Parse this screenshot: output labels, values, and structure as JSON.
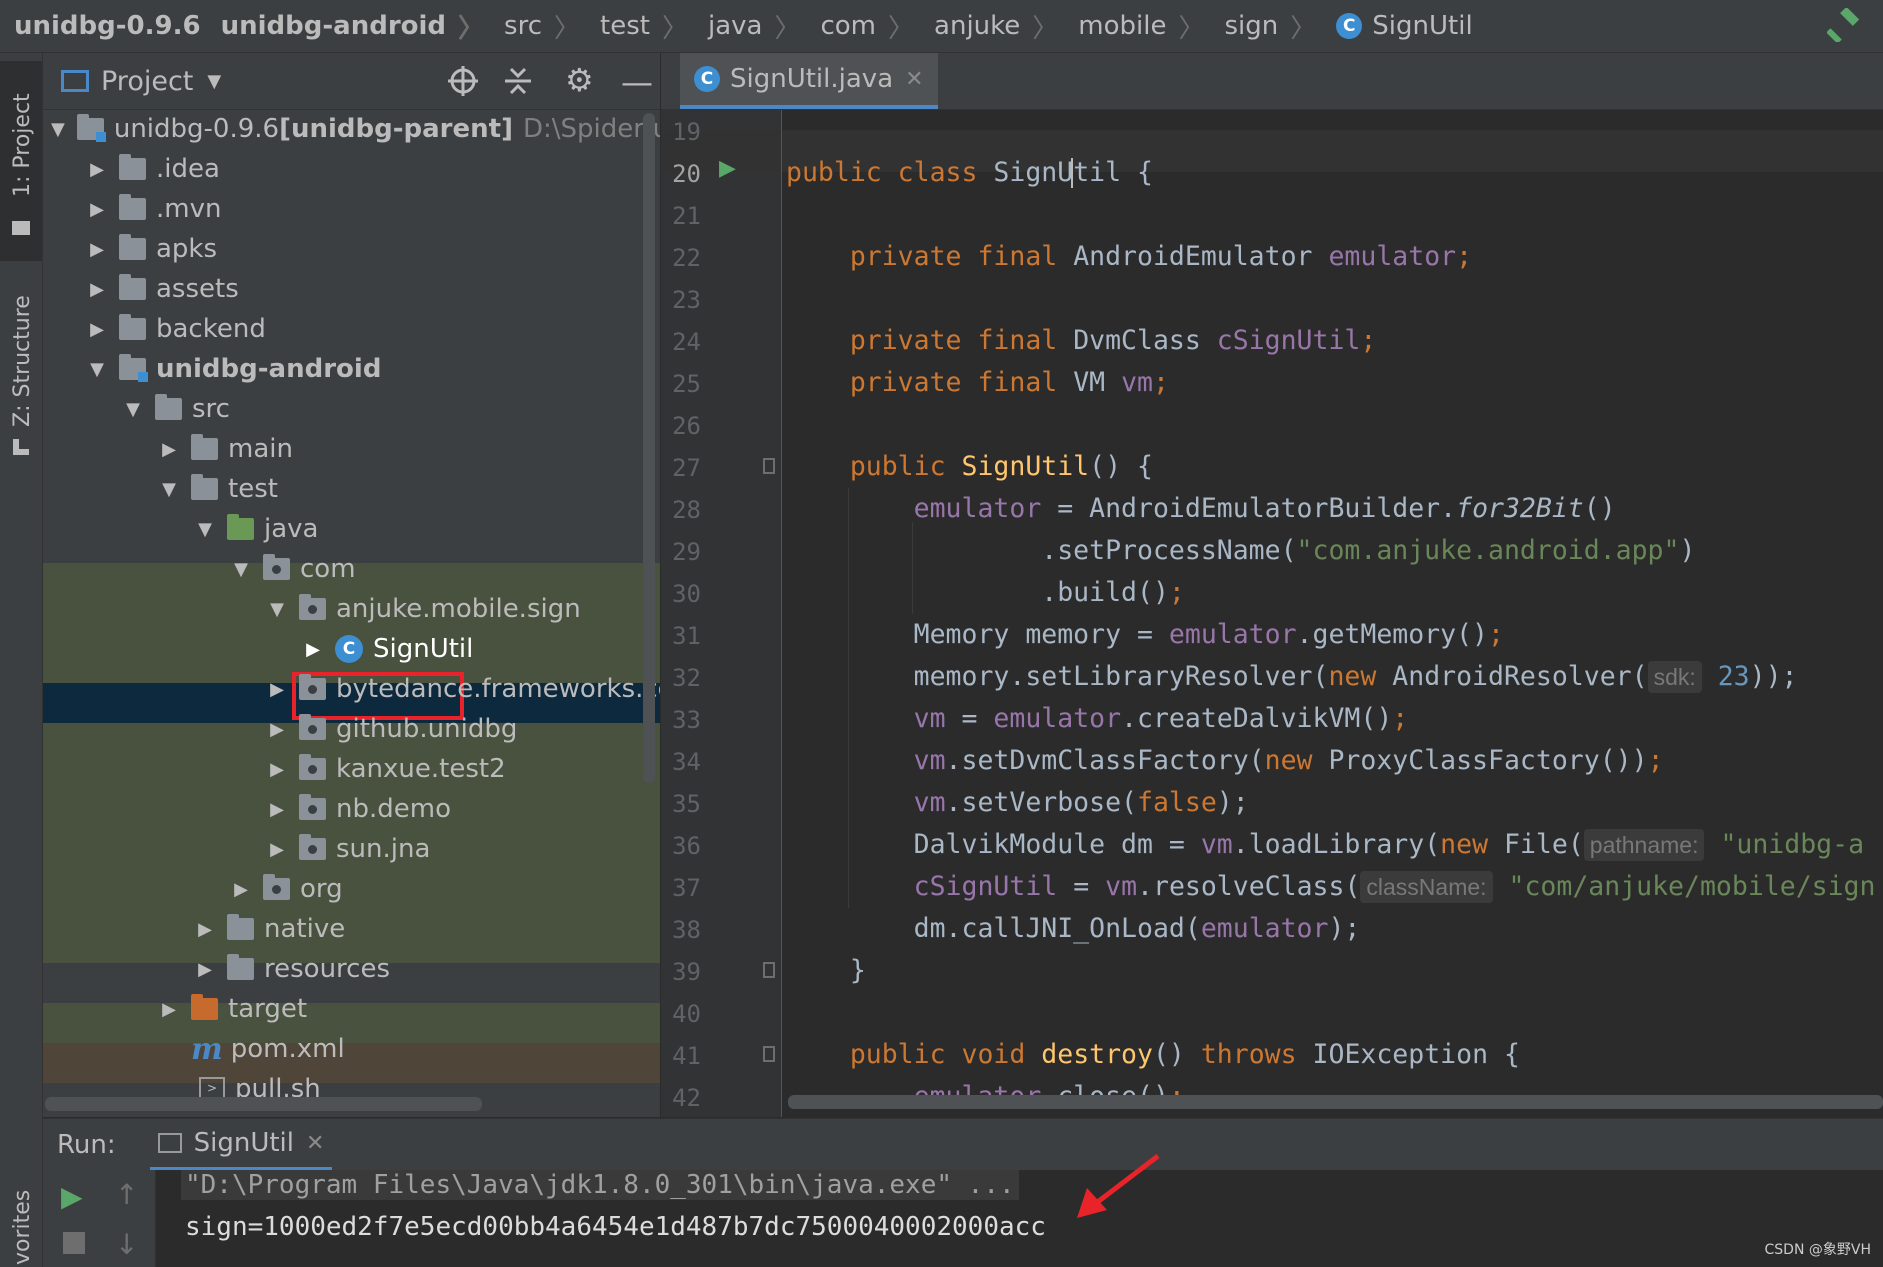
{
  "breadcrumbs": [
    "unidbg-0.9.6",
    "unidbg-android",
    "src",
    "test",
    "java",
    "com",
    "anjuke",
    "mobile",
    "sign",
    "SignUtil"
  ],
  "left_tabs": {
    "project": "1: Project",
    "structure": "Z: Structure",
    "favorites": "vorites"
  },
  "project_panel": {
    "title": "Project",
    "tree": [
      {
        "label": "unidbg-0.9.6",
        "suffix": " [unidbg-parent]",
        "extra": "D:\\Spider\\unidb",
        "depth": 0,
        "open": true,
        "kind": "mod"
      },
      {
        "label": ".idea",
        "depth": 1,
        "open": false,
        "kind": "folder"
      },
      {
        "label": ".mvn",
        "depth": 1,
        "open": false,
        "kind": "folder"
      },
      {
        "label": "apks",
        "depth": 1,
        "open": false,
        "kind": "folder"
      },
      {
        "label": "assets",
        "depth": 1,
        "open": false,
        "kind": "folder"
      },
      {
        "label": "backend",
        "depth": 1,
        "open": false,
        "kind": "folder"
      },
      {
        "label": "unidbg-android",
        "depth": 1,
        "open": true,
        "kind": "mod",
        "bold": true
      },
      {
        "label": "src",
        "depth": 2,
        "open": true,
        "kind": "folder"
      },
      {
        "label": "main",
        "depth": 3,
        "open": false,
        "kind": "folder"
      },
      {
        "label": "test",
        "depth": 3,
        "open": true,
        "kind": "folder"
      },
      {
        "label": "java",
        "depth": 4,
        "open": true,
        "kind": "green"
      },
      {
        "label": "com",
        "depth": 5,
        "open": true,
        "kind": "pkg"
      },
      {
        "label": "anjuke.mobile.sign",
        "depth": 6,
        "open": true,
        "kind": "pkg"
      },
      {
        "label": "SignUtil",
        "depth": 7,
        "open": false,
        "kind": "class",
        "selected": true
      },
      {
        "label": "bytedance.frameworks.core.",
        "depth": 6,
        "open": false,
        "kind": "pkg"
      },
      {
        "label": "github.unidbg",
        "depth": 6,
        "open": false,
        "kind": "pkg"
      },
      {
        "label": "kanxue.test2",
        "depth": 6,
        "open": false,
        "kind": "pkg"
      },
      {
        "label": "nb.demo",
        "depth": 6,
        "open": false,
        "kind": "pkg"
      },
      {
        "label": "sun.jna",
        "depth": 6,
        "open": false,
        "kind": "pkg"
      },
      {
        "label": "org",
        "depth": 5,
        "open": false,
        "kind": "pkg"
      },
      {
        "label": "native",
        "depth": 4,
        "open": false,
        "kind": "folder"
      },
      {
        "label": "resources",
        "depth": 4,
        "open": false,
        "kind": "res"
      },
      {
        "label": "target",
        "depth": 2,
        "open": false,
        "kind": "orange"
      },
      {
        "label": "pom.xml",
        "depth": 2,
        "open": null,
        "kind": "maven"
      },
      {
        "label": "pull.sh",
        "depth": 2,
        "open": null,
        "kind": "shell"
      }
    ]
  },
  "editor": {
    "tab_label": "SignUtil.java",
    "line_numbers": [
      "19",
      "20",
      "21",
      "22",
      "23",
      "24",
      "25",
      "26",
      "27",
      "28",
      "29",
      "30",
      "31",
      "32",
      "33",
      "34",
      "35",
      "36",
      "37",
      "38",
      "39",
      "40",
      "41",
      "42"
    ],
    "code": {
      "l20": {
        "kw1": "public class ",
        "cls1": "SignU",
        "cls2": "til",
        "rest": " {"
      },
      "l22": {
        "kw": "    private final ",
        "type": "AndroidEmulator ",
        "field": "emulator",
        "end": ";"
      },
      "l24": {
        "kw": "    private final ",
        "type": "DvmClass ",
        "field": "cSignUtil",
        "end": ";"
      },
      "l25": {
        "kw": "    private final ",
        "type": "VM ",
        "field": "vm",
        "end": ";"
      },
      "l27": {
        "kw": "    public ",
        "fn": "SignUtil",
        "rest": "() {"
      },
      "l28": {
        "field": "        emulator",
        "mid": " = AndroidEmulatorBuilder.",
        "it": "for32Bit",
        "end": "()"
      },
      "l29": {
        "pre": "                .setProcessName(",
        "str": "\"com.anjuke.android.app\"",
        "end": ")"
      },
      "l30": {
        "pre": "                .build()",
        "end": ";"
      },
      "l31": {
        "pre": "        Memory memory = ",
        "field": "emulator",
        "mid": ".getMemory()",
        "end": ";"
      },
      "l32": {
        "pre": "        memory.setLibraryResolver(",
        "kw": "new ",
        "mid": "AndroidResolver(",
        "hint": "sdk:",
        "num": "23",
        "end": "));"
      },
      "l33": {
        "field1": "        vm",
        "mid": " = ",
        "field2": "emulator",
        "rest": ".createDalvikVM()",
        "end": ";"
      },
      "l34": {
        "field": "        vm",
        "mid": ".setDvmClassFactory(",
        "kw": "new ",
        "rest": "ProxyClassFactory())",
        "end": ";"
      },
      "l35": {
        "field": "        vm",
        "mid": ".setVerbose(",
        "kw": "false",
        "end": ");"
      },
      "l36": {
        "pre": "        DalvikModule dm = ",
        "field": "vm",
        "mid": ".loadLibrary(",
        "kw": "new ",
        "rest": "File(",
        "hint": "pathname:",
        "str": "\"unidbg-a"
      },
      "l37": {
        "field": "        cSignUtil",
        "mid": " = ",
        "field2": "vm",
        "rest": ".resolveClass(",
        "hint": "className:",
        "str": "\"com/anjuke/mobile/sign"
      },
      "l38": {
        "pre": "        dm.callJNI_OnLoad(",
        "field": "emulator",
        "end": ");"
      },
      "l39": {
        "pre": "    }"
      },
      "l41": {
        "kw": "    public void ",
        "fn": "destroy",
        "mid": "() ",
        "kw2": "throws ",
        "rest": "IOException {"
      },
      "l42": {
        "field": "        emulator",
        "mid": ".close()",
        "end": ";"
      }
    }
  },
  "run_panel": {
    "label": "Run:",
    "tab_label": "SignUtil",
    "console": [
      "\"D:\\Program Files\\Java\\jdk1.8.0_301\\bin\\java.exe\" ...",
      "sign=1000ed2f7e5ecd00bb4a6454e1d487b7dc7500040002000acc"
    ]
  },
  "watermark": "CSDN @象野VH",
  "colors": {
    "accent": "#4a88c7",
    "highlight_box": "#e8242a",
    "selection": "#0d293e",
    "keyword": "#cc7832",
    "string": "#6a8759",
    "field": "#9876aa",
    "function": "#ffc66d"
  }
}
